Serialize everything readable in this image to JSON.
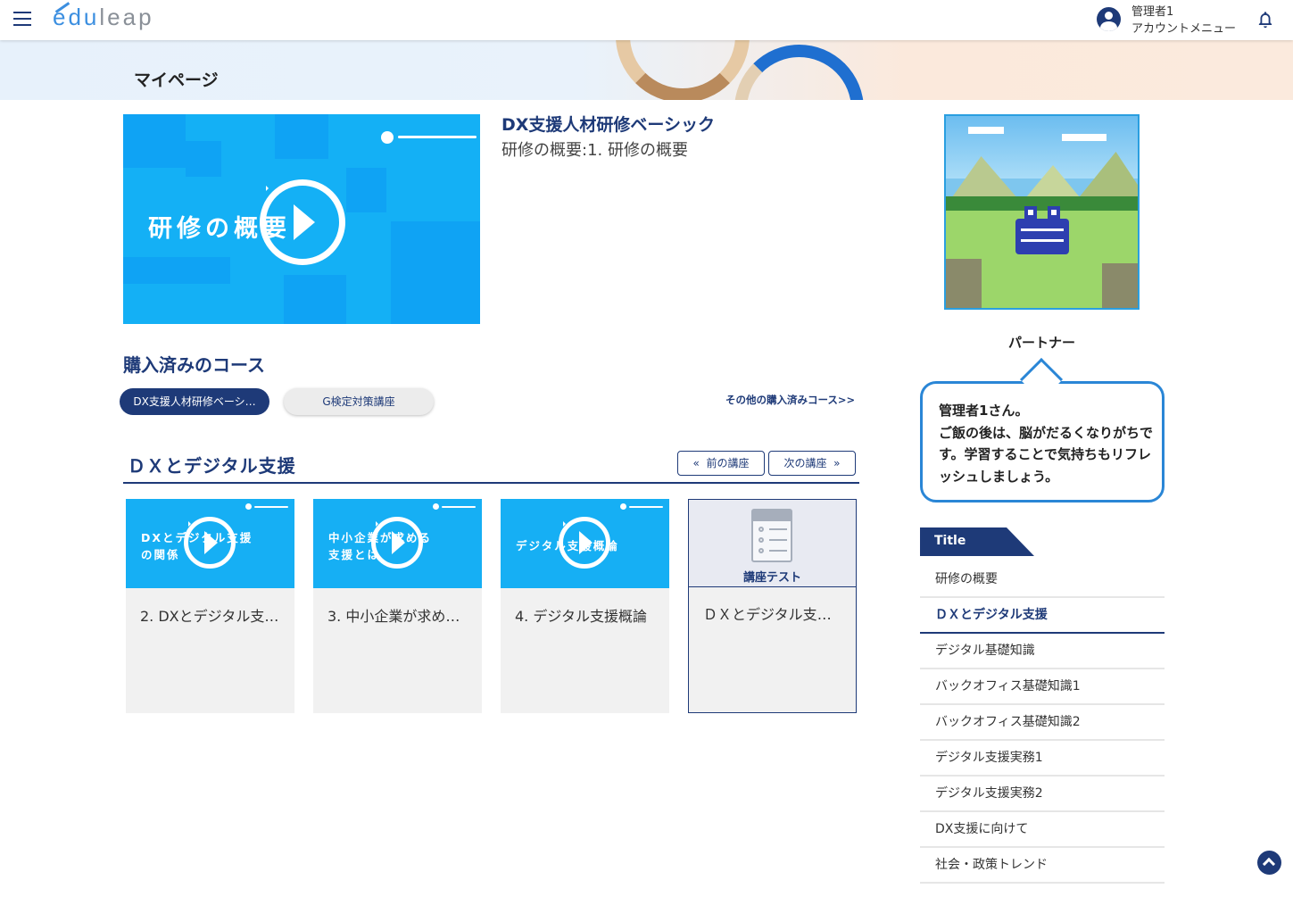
{
  "header": {
    "logo": {
      "text_accent": "edu",
      "text_rest": "leap"
    },
    "user_name": "管理者1",
    "account_menu": "アカウントメニュー"
  },
  "banner": {
    "title": "マイページ"
  },
  "hero": {
    "thumb_text": "研修の概要",
    "course_title": "DX支援人材研修ベーシック",
    "lesson_title": "研修の概要:1. 研修の概要"
  },
  "purchased": {
    "heading": "購入済みのコース",
    "courses": [
      {
        "label": "DX支援人材研修ベーシ…",
        "active": true
      },
      {
        "label": "G検定対策講座",
        "active": false
      }
    ],
    "other_link": "その他の購入済みコース>>"
  },
  "chapter": {
    "title": "ＤＸとデジタル支援",
    "prev_label": "前の講座",
    "next_label": "次の講座",
    "cards": [
      {
        "thumb_text": "DXとデジタル支援\nの関係",
        "label": "2. DXとデジタル支…"
      },
      {
        "thumb_text": "中小企業が求める\n支援とは",
        "label": "3. 中小企業が求め…"
      },
      {
        "thumb_text": "デジタル支援概論",
        "label": "4. デジタル支援概論"
      }
    ],
    "test_card": {
      "caption": "講座テスト",
      "label": "ＤＸとデジタル支援…"
    }
  },
  "partner": {
    "label": "パートナー",
    "message": "管理者1さん。\nご飯の後は、脳がだるくなりがちです。学習することで気持ちもリフレッシュしましょう。"
  },
  "toc": {
    "heading": "Title",
    "items": [
      {
        "label": "研修の概要",
        "active": false
      },
      {
        "label": "ＤＸとデジタル支援",
        "active": true
      },
      {
        "label": "デジタル基礎知識",
        "active": false
      },
      {
        "label": "バックオフィス基礎知識1",
        "active": false
      },
      {
        "label": "バックオフィス基礎知識2",
        "active": false
      },
      {
        "label": "デジタル支援実務1",
        "active": false
      },
      {
        "label": "デジタル支援実務2",
        "active": false
      },
      {
        "label": "DX支援に向けて",
        "active": false
      },
      {
        "label": "社会・政策トレンド",
        "active": false
      }
    ]
  },
  "colors": {
    "navy": "#1e3a78",
    "sky": "#14b0f5",
    "bubble_border": "#2a86d6"
  },
  "icons": [
    "menu-icon",
    "user-circle-icon",
    "bell-icon",
    "play-icon",
    "chevrons-left-icon",
    "chevrons-right-icon",
    "test-sheet-icon",
    "chevron-up-icon"
  ]
}
